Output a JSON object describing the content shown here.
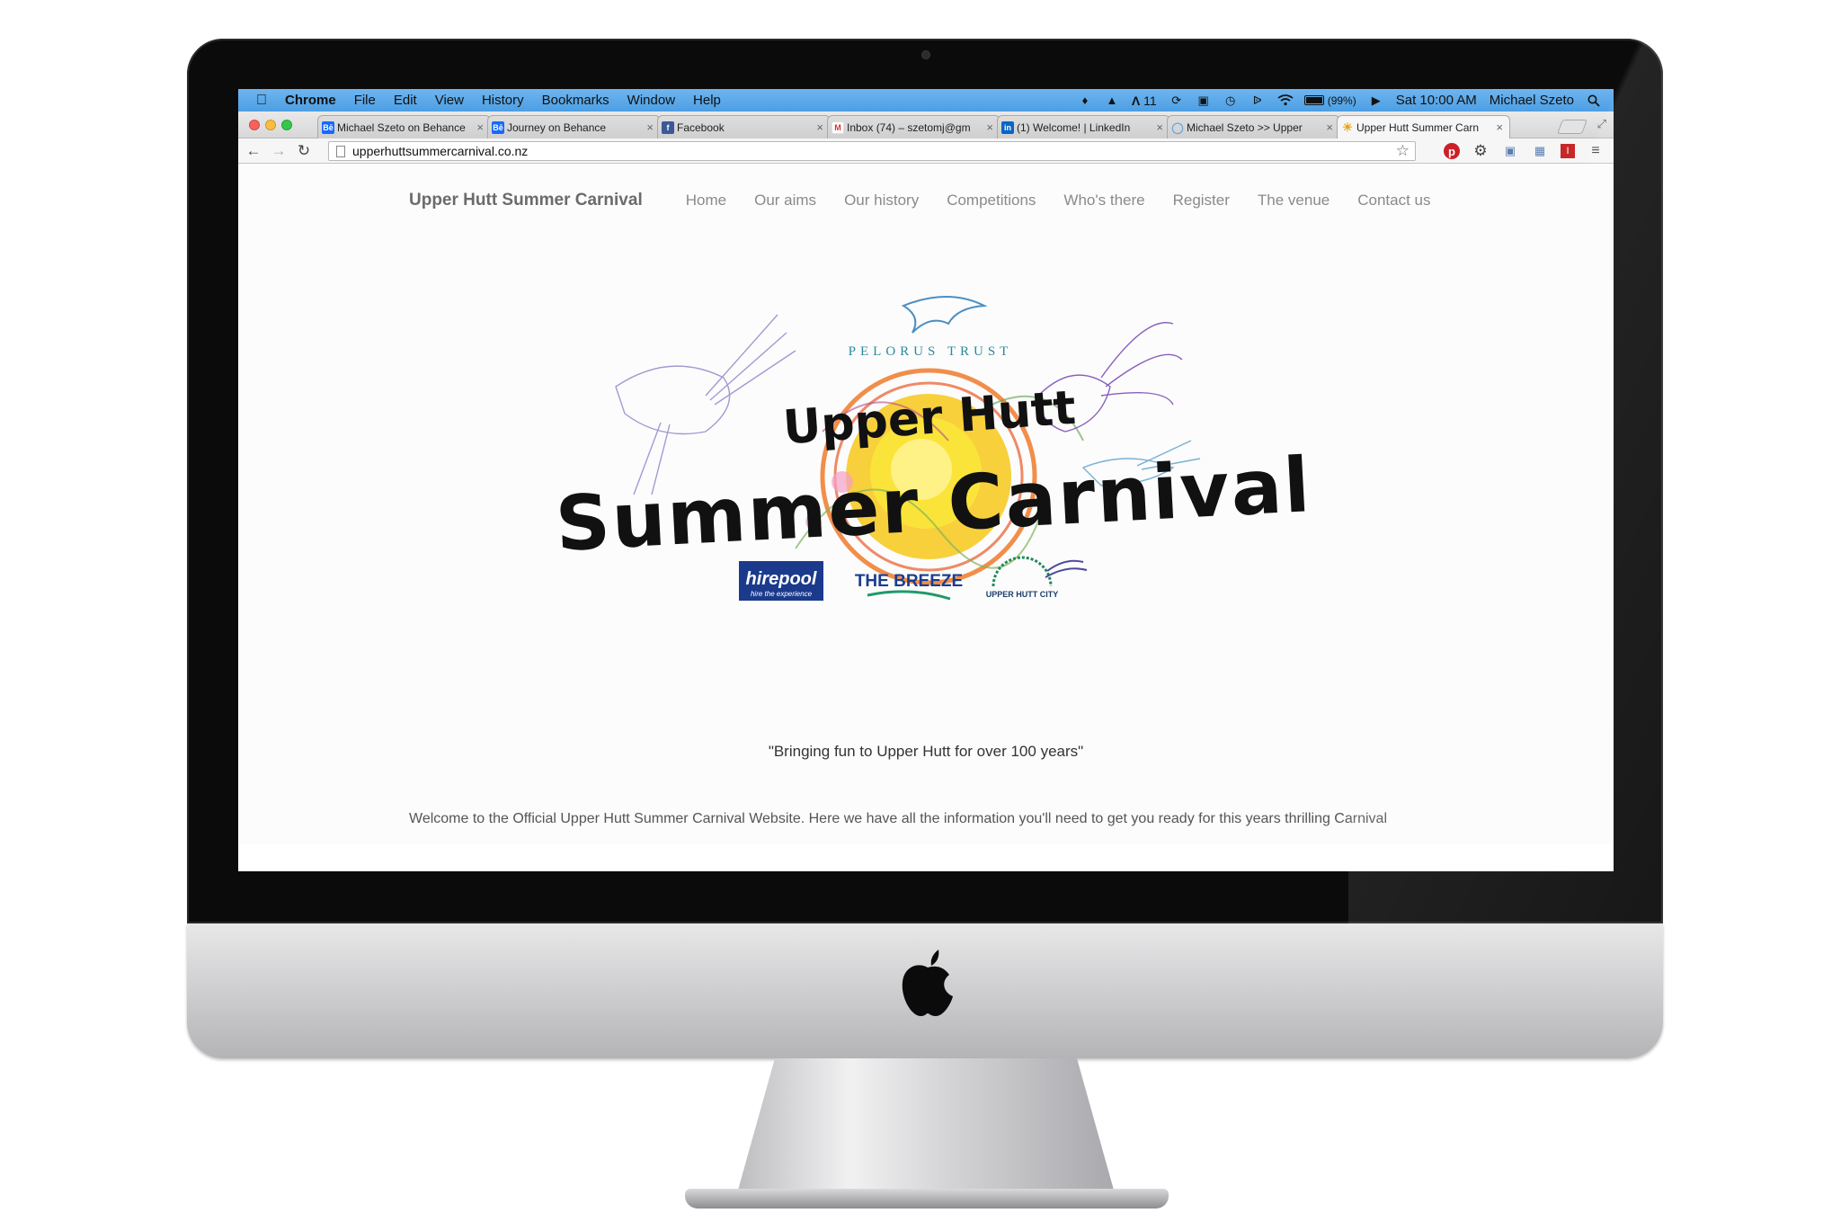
{
  "menubar": {
    "app_name": "Chrome",
    "items": [
      "File",
      "Edit",
      "View",
      "History",
      "Bookmarks",
      "Window",
      "Help"
    ],
    "status": {
      "notifications_count": "11",
      "battery": "(99%)",
      "clock": "Sat 10:00 AM",
      "user": "Michael Szeto"
    }
  },
  "tabs": [
    {
      "title": "Michael Szeto on Behance",
      "favicon": "Bē",
      "color": "#1769ff",
      "active": false
    },
    {
      "title": "Journey on Behance",
      "favicon": "Bē",
      "color": "#1769ff",
      "active": false
    },
    {
      "title": "Facebook",
      "favicon": "f",
      "color": "#3b5998",
      "active": false
    },
    {
      "title": "Inbox (74) – szetomj@gm",
      "favicon": "M",
      "color": "#d93025",
      "active": false
    },
    {
      "title": "(1) Welcome! | LinkedIn",
      "favicon": "in",
      "color": "#0a66c2",
      "active": false
    },
    {
      "title": "Michael Szeto >> Upper",
      "favicon": "◯",
      "color": "#6ea3d8",
      "active": false
    },
    {
      "title": "Upper Hutt Summer Carn",
      "favicon": "☀",
      "color": "#e8a316",
      "active": true
    }
  ],
  "address_bar": {
    "url": "upperhuttsummercarnival.co.nz"
  },
  "site": {
    "brand": "Upper Hutt Summer Carnival",
    "nav": [
      "Home",
      "Our aims",
      "Our history",
      "Competitions",
      "Who's there",
      "Register",
      "The venue",
      "Contact us"
    ],
    "logo": {
      "line1": "Upper Hutt",
      "line2": "Summer Carnival",
      "sponsor_top": "PELORUS TRUST",
      "sponsors": [
        "hirepool",
        "THE BREEZE",
        "UPPER HUTT CITY"
      ],
      "hirepool_tagline": "hire the experience"
    },
    "tagline": "\"Bringing fun to Upper Hutt for over 100 years\"",
    "welcome": "Welcome to the Official Upper Hutt Summer Carnival Website. Here we have all the information you'll need to get you ready for this years thrilling Carnival"
  },
  "colors": {
    "menubar_blue": "#5aa8e8",
    "sun_yellow": "#f6d21b",
    "sun_orange": "#ee7a2a",
    "hirepool_blue": "#1b3a8c",
    "breeze_blue": "#1a3d8f",
    "breeze_green": "#1f9a6a"
  }
}
